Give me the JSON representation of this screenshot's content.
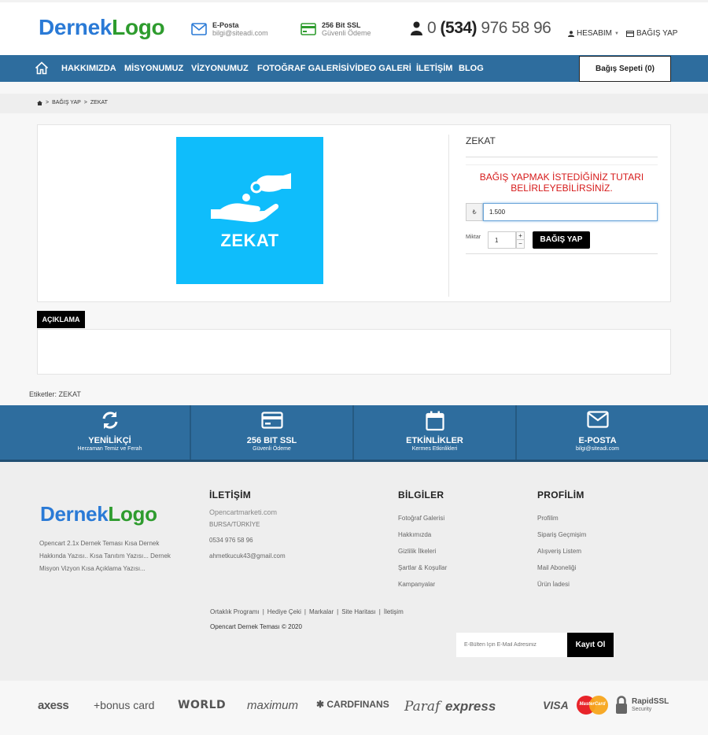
{
  "header": {
    "logo_part1": "Dernek",
    "logo_part2": "Logo",
    "email_title": "E-Posta",
    "email_value": "bilgi@siteadi.com",
    "ssl_title": "256 Bit SSL",
    "ssl_value": "Güvenli Ödeme",
    "phone_prefix": "0",
    "phone_area": "(534)",
    "phone_number": "976 58 96",
    "account_label": "HESABIM",
    "donate_link": "BAĞIŞ YAP"
  },
  "nav": {
    "items": [
      "HAKKIMIZDA",
      "MİSYONUMUZ",
      "VİZYONUMUZ",
      "FOTOĞRAF GALERİSİ",
      "VİDEO GALERİ",
      "İLETİŞİM",
      "BLOG"
    ],
    "cart_label": "Bağış Sepeti (0)"
  },
  "breadcrumb": {
    "items": [
      "BAĞIŞ YAP",
      "ZEKAT"
    ]
  },
  "product": {
    "image_label": "ZEKAT",
    "title": "ZEKAT",
    "notice": "BAĞIŞ YAPMAK İSTEDİĞİNİZ TUTARI BELİRLEYEBİLİRSİNİZ.",
    "currency_symbol": "₺",
    "amount_value": "1.500",
    "quantity_label": "Miktar",
    "quantity_value": "1",
    "donate_button": "BAĞIŞ YAP"
  },
  "description": {
    "tab_label": "AÇIKLAMA"
  },
  "tags": {
    "text": "Etiketler: ZEKAT"
  },
  "features": [
    {
      "title": "YENİLİKÇİ",
      "subtitle": "Herzaman Temiz ve Ferah",
      "icon": "refresh-icon"
    },
    {
      "title": "256 BIT SSL",
      "subtitle": "Güvenli Ödeme",
      "icon": "credit-card-icon"
    },
    {
      "title": "ETKİNLİKLER",
      "subtitle": "Kermes Etkinlikleri",
      "icon": "calendar-icon"
    },
    {
      "title": "E-POSTA",
      "subtitle": "bilgi@siteadi.com",
      "icon": "envelope-icon"
    }
  ],
  "footer": {
    "logo_part1": "Dernek",
    "logo_part2": "Logo",
    "description": "Opencart 2.1x Dernek Teması Kısa Dernek Hakkında Yazısı.. Kısa Tanıtım Yazısı... Dernek Misyon Vizyon Kısa Açıklama Yazısı...",
    "contact_heading": "İLETİŞİM",
    "contact_site": "Opencartmarketi.com",
    "contact_city": "BURSA/TÜRKİYE",
    "contact_phone": "0534 976 58 96",
    "contact_email": "ahmetkucuk43@gmail.com",
    "info_heading": "BİLGİLER",
    "info_links": [
      "Fotoğraf Galerisi",
      "Hakkımızda",
      "Gizlilik İlkeleri",
      "Şartlar & Koşullar",
      "Kampanyalar"
    ],
    "profile_heading": "PROFİLİM",
    "profile_links": [
      "Profilim",
      "Sipariş Geçmişim",
      "Alışveriş Listem",
      "Mail Aboneliği",
      "Ürün İadesi"
    ],
    "bottom_links": [
      "Ortaklık Programı",
      "Hediye Çeki",
      "Markalar",
      "Site Haritası",
      "İletişim"
    ],
    "copyright": "Opencart Dernek Teması © 2020",
    "newsletter_placeholder": "E-Bülten İçin E-Mail Adresiniz",
    "newsletter_button": "Kayıt Ol"
  },
  "payments": {
    "brands": [
      "axess",
      "+bonus card",
      "WORLD",
      "maximum",
      "CARDFINANS",
      "Paraf",
      "express",
      "VISA",
      "MasterCard",
      "RapidSSL",
      "Security"
    ]
  },
  "colors": {
    "brand_blue": "#2e6d9e",
    "logo_blue": "#2a7ad6",
    "logo_green": "#2e9c2e",
    "zekat_bg": "#0fbdfb",
    "warning_red": "#d61a1a"
  }
}
